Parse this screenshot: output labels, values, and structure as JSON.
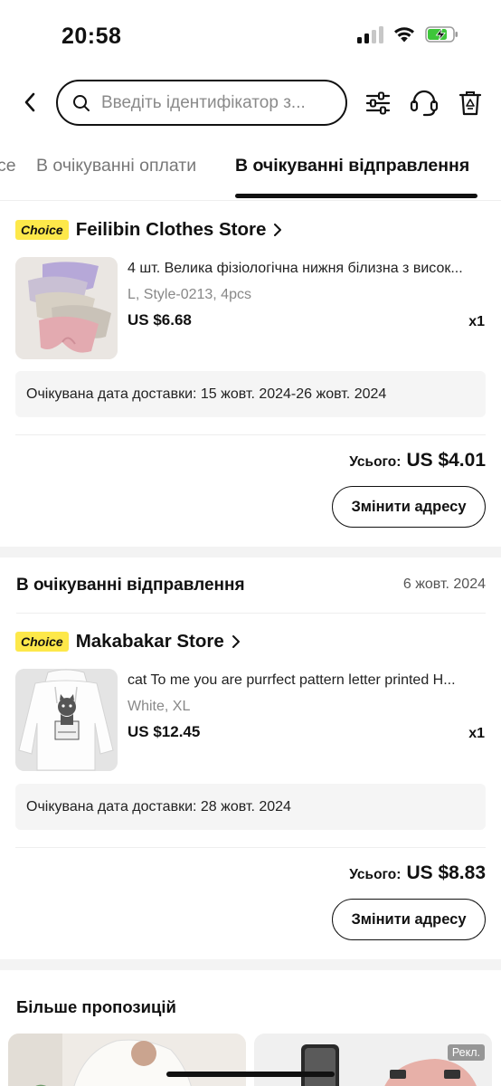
{
  "status_bar": {
    "time": "20:58"
  },
  "header": {
    "search_placeholder": "Введіть ідентифікатор з..."
  },
  "tabs": [
    {
      "label": "се"
    },
    {
      "label": "В очікуванні оплати"
    },
    {
      "label": "В очікуванні відправлення",
      "active": true
    }
  ],
  "orders": [
    {
      "choice_label": "Choice",
      "store": "Feilibin Clothes Store",
      "product_title": "4 шт. Велика фізіологічна нижня білизна з висок...",
      "variant": "L, Style-0213, 4pcs",
      "price": "US $6.68",
      "qty": "x1",
      "delivery": "Очікувана дата доставки: 15 жовт. 2024-26 жовт. 2024",
      "total_label": "Усього:",
      "total": "US $4.01",
      "change_address": "Змінити адресу"
    },
    {
      "status": "В очікуванні відправлення",
      "date": "6 жовт. 2024",
      "choice_label": "Choice",
      "store": "Makabakar Store",
      "product_title": "cat To me you are purrfect pattern letter printed H...",
      "variant": "White, XL",
      "price": "US $12.45",
      "qty": "x1",
      "delivery": "Очікувана дата доставки: 28 жовт. 2024",
      "total_label": "Усього:",
      "total": "US $8.83",
      "change_address": "Змінити адресу"
    }
  ],
  "recommendations": {
    "title": "Більше пропозицій",
    "ad_label": "Рекл."
  },
  "colors": {
    "choice_badge": "#fde84a",
    "battery_fill": "#3ec63a",
    "text_primary": "#111111"
  }
}
